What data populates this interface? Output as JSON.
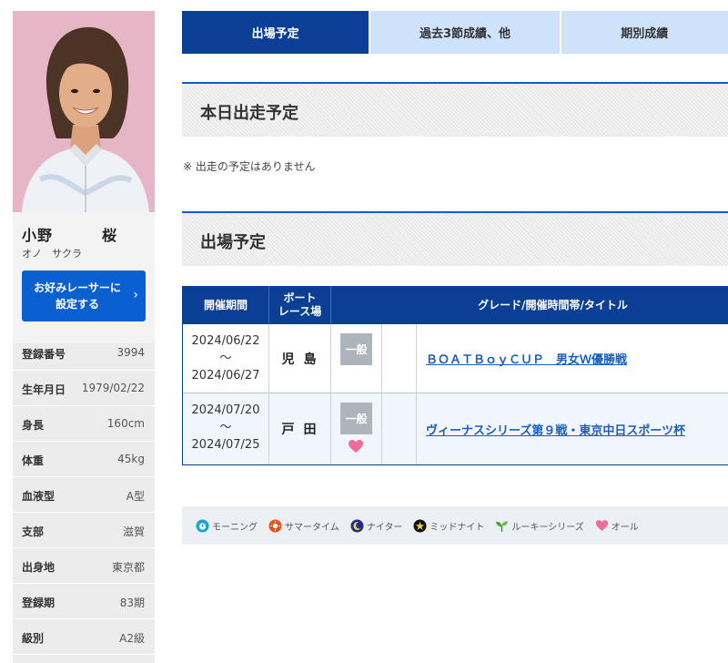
{
  "profile": {
    "name_family": "小野",
    "name_given": "桜",
    "kana": "オノ　サクラ",
    "favorite_button": {
      "line1": "お好みレーサーに",
      "line2": "設定する",
      "chevron": "›"
    },
    "stats": [
      {
        "label": "登録番号",
        "value": "3994"
      },
      {
        "label": "生年月日",
        "value": "1979/02/22"
      },
      {
        "label": "身長",
        "value": "160cm"
      },
      {
        "label": "体重",
        "value": "45kg"
      },
      {
        "label": "血液型",
        "value": "A型"
      },
      {
        "label": "支部",
        "value": "滋賀"
      },
      {
        "label": "出身地",
        "value": "東京都"
      },
      {
        "label": "登録期",
        "value": "83期"
      },
      {
        "label": "級別",
        "value": "A2級"
      }
    ]
  },
  "tabs": [
    {
      "label": "出場予定",
      "active": true
    },
    {
      "label": "過去3節成績、他",
      "active": false
    },
    {
      "label": "期別成績",
      "active": false
    }
  ],
  "today": {
    "heading": "本日出走予定",
    "notice": "※ 出走の予定はありません"
  },
  "upcoming": {
    "heading": "出場予定",
    "columns": {
      "period": "開催期間",
      "venue_line1": "ボート",
      "venue_line2": "レース場",
      "grade_title": "グレード/開催時間帯/タイトル"
    },
    "rows": [
      {
        "start": "2024/06/22",
        "tilde": "～",
        "end": "2024/06/27",
        "venue": "児島",
        "grade": "一般",
        "ladies": false,
        "title": "ＢＯＡＴＢｏｙＣＵＰ　男女Ｗ優勝戦"
      },
      {
        "start": "2024/07/20",
        "tilde": "～",
        "end": "2024/07/25",
        "venue": "戸田",
        "grade": "一般",
        "ladies": true,
        "title": "ヴィーナスシリーズ第９戦・東京中日スポーツ杯"
      }
    ]
  },
  "legend": [
    {
      "icon": "morning-icon",
      "label": "モーニング",
      "color": "#1aa3d9"
    },
    {
      "icon": "summer-time-icon",
      "label": "サマータイム",
      "color": "#e8531a"
    },
    {
      "icon": "nighter-icon",
      "label": "ナイター",
      "color": "#1d2f8c"
    },
    {
      "icon": "midnight-icon",
      "label": "ミッドナイト",
      "color": "#111111"
    },
    {
      "icon": "rookie-series-icon",
      "label": "ルーキーシリーズ",
      "color": "#45a632"
    },
    {
      "icon": "ladies-icon",
      "label": "オール",
      "color": "#ef6c9a"
    }
  ],
  "colors": {
    "accent": "#0b3f95",
    "tab_inactive": "#cfe2fb",
    "button": "#0a5fd1",
    "link": "#1a5fbf",
    "heart": "#ef6c9a"
  }
}
